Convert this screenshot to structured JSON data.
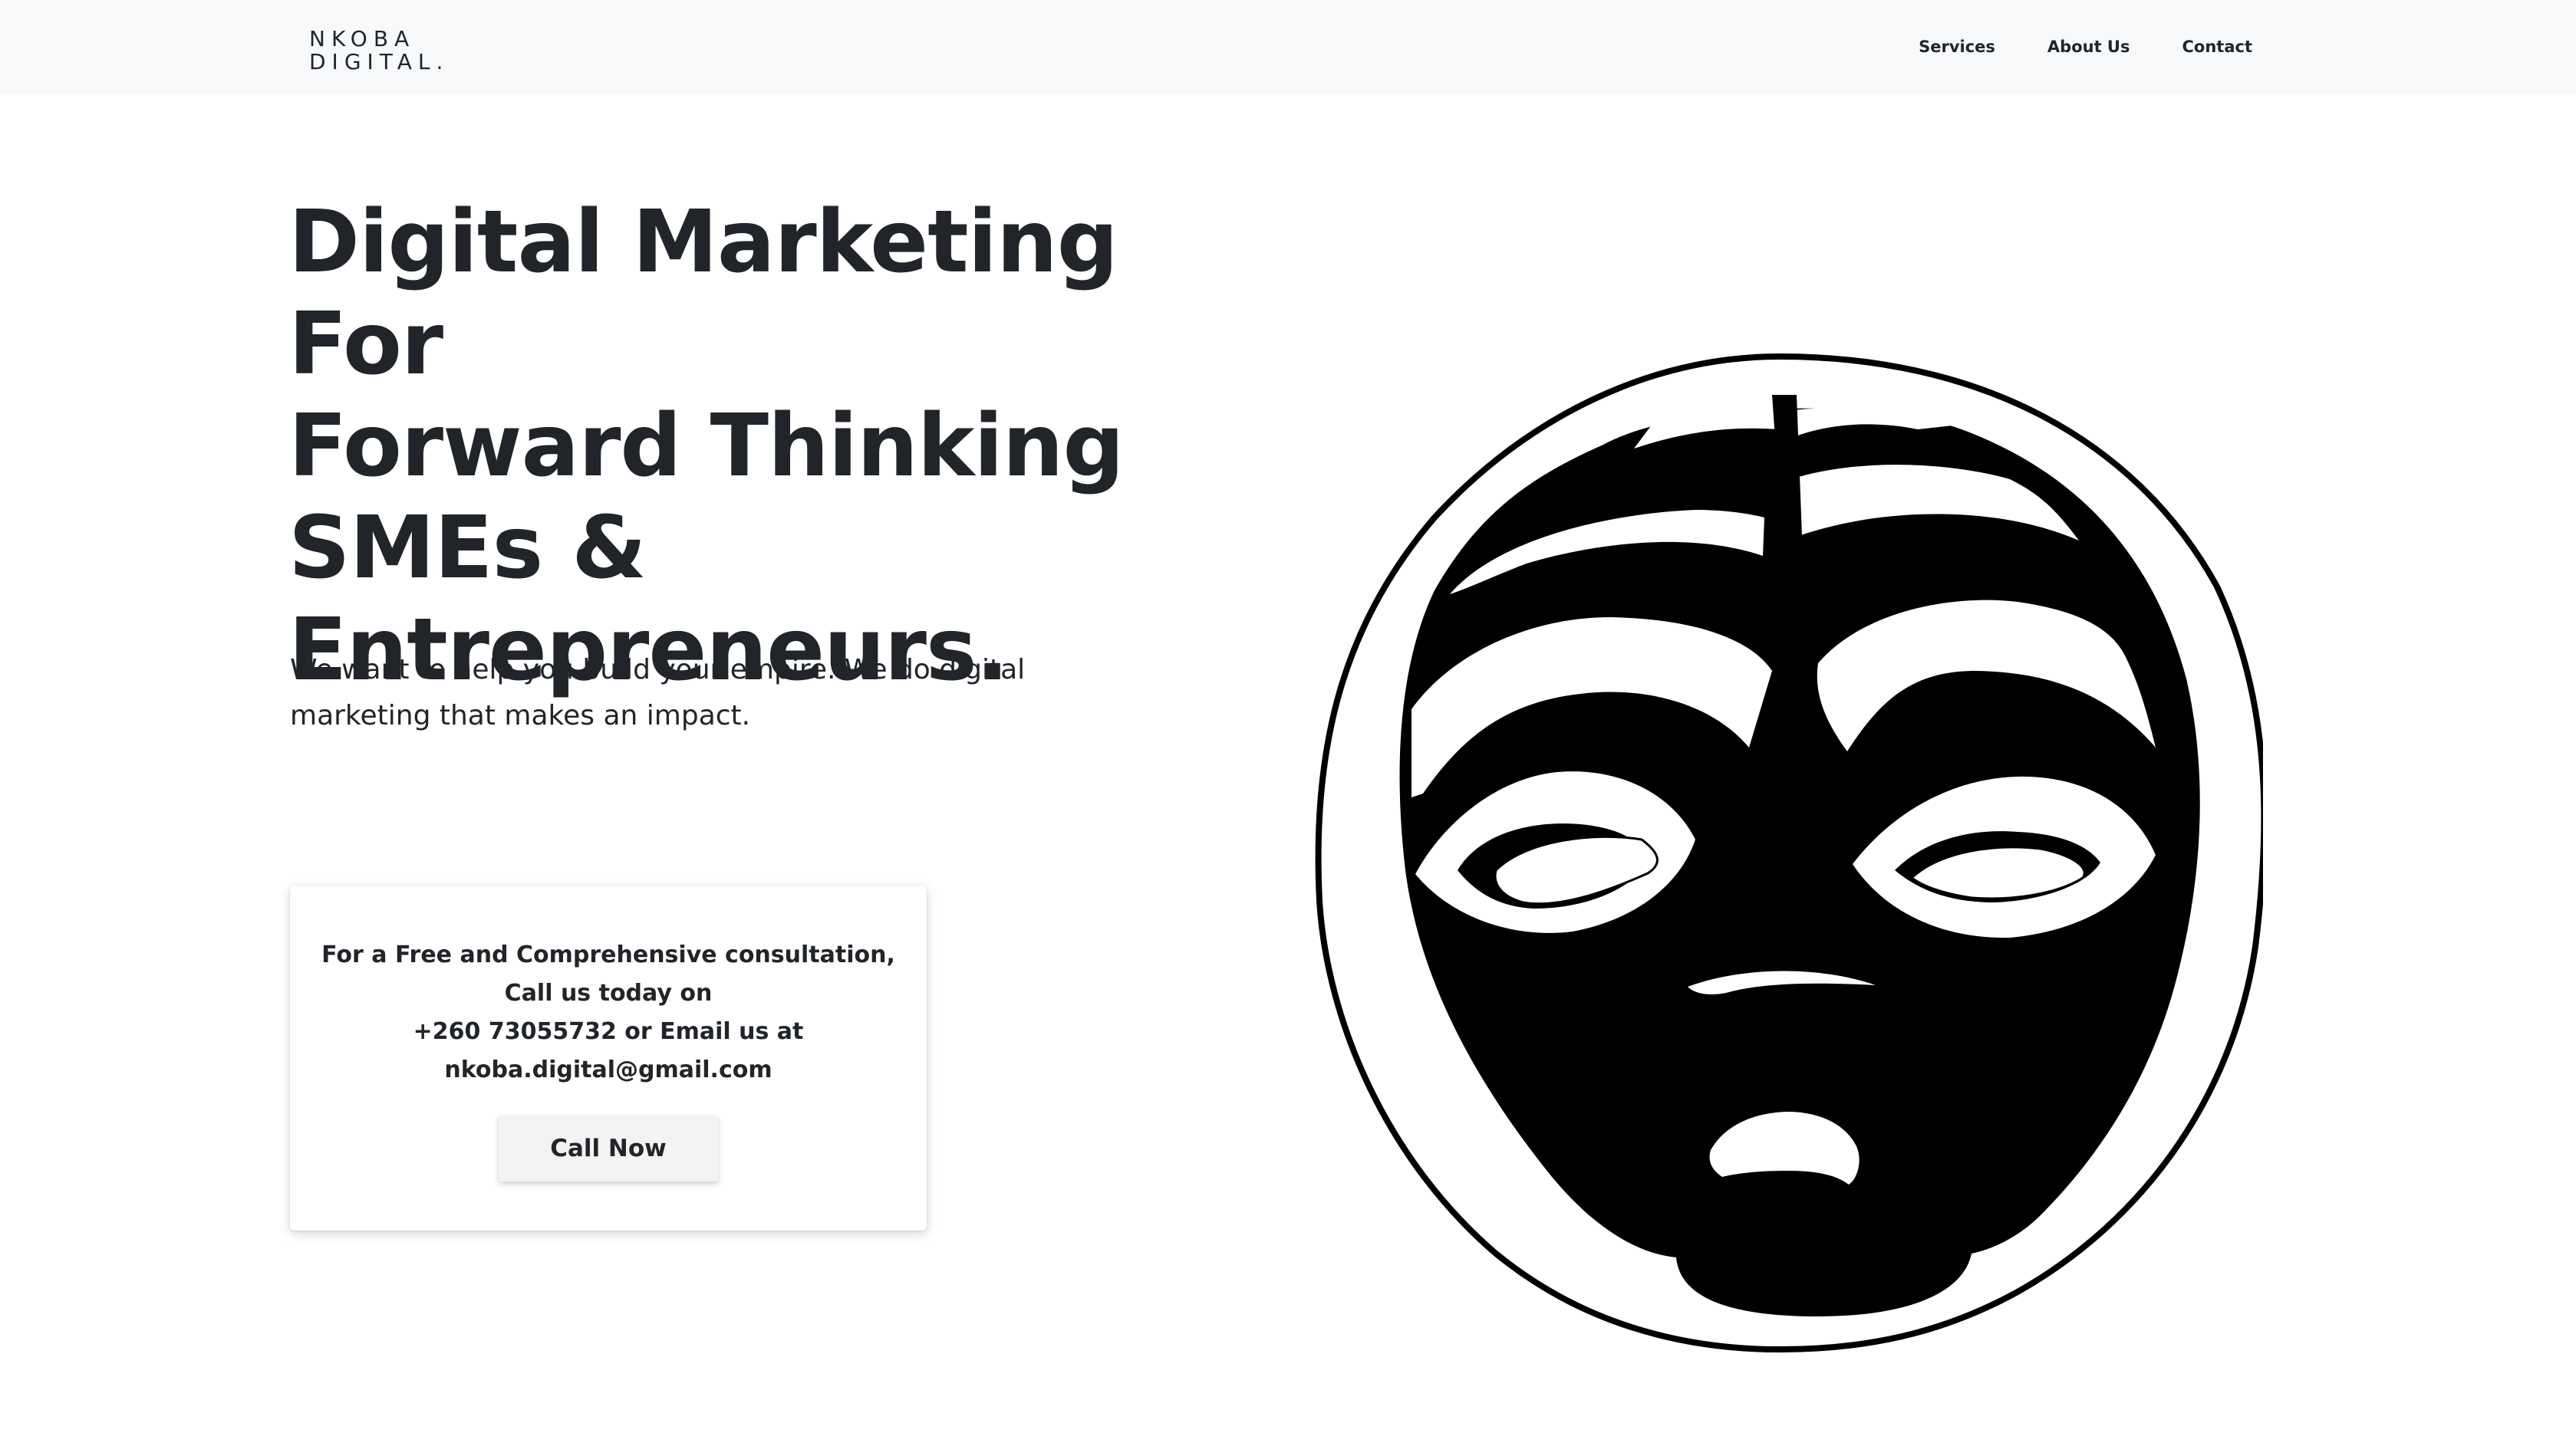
{
  "brand": {
    "line1": "NKOBA",
    "line2": "DIGITAL."
  },
  "nav": {
    "items": [
      {
        "label": "Services"
      },
      {
        "label": "About Us"
      },
      {
        "label": "Contact"
      }
    ]
  },
  "hero": {
    "title_lines": [
      "Digital Marketing For",
      "Forward Thinking",
      "SMEs &",
      "Entrepreneurs."
    ],
    "subtitle_lines": [
      "We want to help you build your empire. We do digital",
      "marketing that makes an impact."
    ]
  },
  "consult": {
    "lines": [
      "For a Free and Comprehensive consultation,",
      "Call us today on",
      "+260 73055732 or Email us at",
      "nkoba.digital@gmail.com"
    ],
    "button_label": "Call Now"
  },
  "illustration": {
    "icon": "african-mask-icon",
    "colors": {
      "ink": "#000000",
      "paper": "#ffffff"
    }
  },
  "colors": {
    "navbar_bg": "#f8f9fa",
    "text": "#212529",
    "button_bg": "#f3f3f3"
  }
}
